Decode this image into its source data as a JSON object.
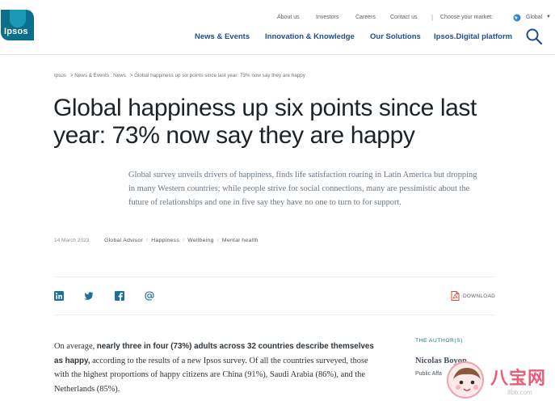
{
  "header": {
    "logo_text": "Ipsos",
    "utility": {
      "about": "About us",
      "investors": "Investors",
      "careers": "Careers",
      "contact": "Contact us",
      "market_prompt": "Choose your market:",
      "market_value": "Global"
    },
    "nav": {
      "news": "News & Events",
      "innovation": "Innovation & Knowledge",
      "solutions": "Our Solutions",
      "digital": "Ipsos.Digital platform"
    }
  },
  "breadcrumb": {
    "home": "Ipsos",
    "section": "> News & Events : News",
    "current": "> Global happiness up six points since last year: 73% now say they are happy"
  },
  "article": {
    "title": "Global happiness up six points since last year: 73% now say they are happy",
    "lead": "Global survey unveils drivers of happiness, finds life satisfaction roaring in Latin America but dropping in many Western countries; while people strive for social connections, many are pessimistic about the future of relationships and one in five say they have no one to turn to for support.",
    "date": "14 March 2023",
    "tags": [
      "Global Advisor",
      "Happiness",
      "Wellbeing",
      "Mental health"
    ],
    "download_label": "DOWNLOAD",
    "body": {
      "intro": "On average, ",
      "highlight": "nearly three in four (73%) adults across 32 countries describe themselves as happy,",
      "rest": " according to the results of a new Ipsos survey. Of all the countries surveyed, those with the highest proportions of happy citizens are China (91%), Saudi Arabia (86%), and the Netherlands (85%)."
    }
  },
  "author": {
    "heading": "THE AUTHOR(S)",
    "name": "Nicolas Boyon",
    "role": "Public Affa"
  },
  "share_icons": [
    "linkedin-icon",
    "twitter-icon",
    "facebook-icon",
    "email-icon"
  ],
  "watermark": {
    "text": "八宝网",
    "url": "8bb.com"
  },
  "colors": {
    "brand": "#0b6e8a",
    "nav": "#1d4f8c",
    "share": "#1d6f9c",
    "download": "#e0483c"
  }
}
